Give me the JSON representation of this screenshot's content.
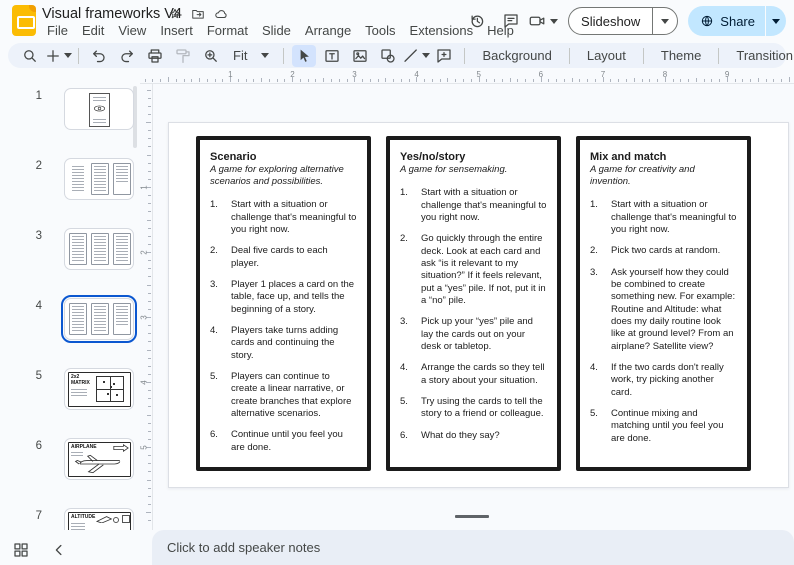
{
  "app": {
    "title": "Visual frameworks V4"
  },
  "menus": [
    "File",
    "Edit",
    "View",
    "Insert",
    "Format",
    "Slide",
    "Arrange",
    "Tools",
    "Extensions",
    "Help"
  ],
  "topbar_right": {
    "slideshow_label": "Slideshow",
    "share_label": "Share"
  },
  "toolbar": {
    "zoom_value": "Fit",
    "background_label": "Background",
    "layout_label": "Layout",
    "theme_label": "Theme",
    "transition_label": "Transition"
  },
  "ruler": {
    "h_numbers": [
      1,
      2,
      3,
      4,
      5,
      6,
      7,
      8,
      9
    ],
    "v_numbers": [
      1,
      2,
      3,
      4,
      5
    ]
  },
  "filmstrip": {
    "slides": [
      {
        "number": "1"
      },
      {
        "number": "2"
      },
      {
        "number": "3"
      },
      {
        "number": "4",
        "selected": true
      },
      {
        "number": "5",
        "title": "2x2 MATRIX"
      },
      {
        "number": "6",
        "title": "AIRPLANE"
      },
      {
        "number": "7",
        "title": "ALTITUDE"
      }
    ]
  },
  "slide": {
    "cards": [
      {
        "title": "Scenario",
        "subtitle": "A game for exploring alternative scenarios and possibilities.",
        "items": [
          "Start with a situation or challenge that's meaningful to you right now.",
          "Deal five cards to each player.",
          "Player 1 places a card on the table, face up, and tells the beginning of a story.",
          "Players take turns adding cards and continuing the story.",
          "Players can continue to create a linear narrative, or create branches that explore alternative scenarios.",
          "Continue until you feel you are done."
        ]
      },
      {
        "title": "Yes/no/story",
        "subtitle": "A game for sensemaking.",
        "items": [
          "Start with a situation or challenge that's meaningful to you right now.",
          "Go quickly through the entire deck. Look at each card and ask “is it relevant to my situation?” If it feels relevant, put a “yes” pile. If not, put it in a “no” pile.",
          "Pick up your “yes” pile and lay the cards out on your desk or tabletop.",
          "Arrange the cards so they tell a story about your situation.",
          "Try using the cards to tell the story to a friend or colleague.",
          "What do they say?"
        ]
      },
      {
        "title": "Mix and match",
        "subtitle": "A game for creativity and invention.",
        "items": [
          "Start with a situation or challenge that's meaningful to you right now.",
          "Pick two cards at random.",
          "Ask yourself how they could be combined to create something new. For example: Routine and Altitude: what does my daily routine look like at ground level? From an airplane? Satellite view?",
          "If the two cards don't really work, try picking another card.",
          "Continue mixing and matching until you feel you are  done."
        ]
      }
    ]
  },
  "notes": {
    "placeholder": "Click to add speaker notes"
  },
  "colors": {
    "accent_blue": "#0b57d0",
    "share_bg": "#c2e7ff",
    "selected_tool_bg": "#d3e3fd",
    "toolbar_bg": "#edf2fa",
    "canvas_bg": "#f8fafd",
    "notes_bg": "#e9eef6",
    "logo_yellow": "#fbbc04"
  }
}
